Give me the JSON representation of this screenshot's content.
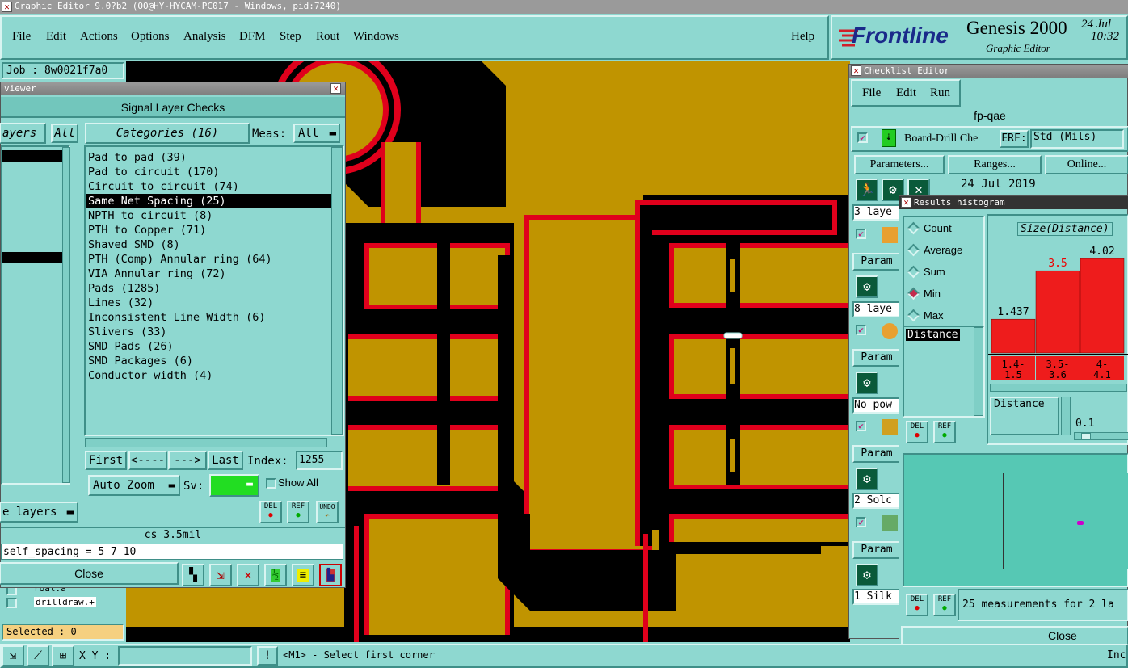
{
  "window_title": "Graphic Editor 9.0?b2 (OO@HY-HYCAM-PC017 - Windows, pid:7240)",
  "menu": [
    "File",
    "Edit",
    "Actions",
    "Options",
    "Analysis",
    "DFM",
    "Step",
    "Rout",
    "Windows"
  ],
  "help": "Help",
  "brand": {
    "logo": "Frontline",
    "product": "Genesis 2000",
    "subtitle": "Graphic Editor",
    "date": "24 Jul",
    "time": "10:32"
  },
  "job": "Job : 8w0021f7a0",
  "viewer": {
    "title": "viewer",
    "heading": "Signal Layer Checks",
    "layers_tab": "ayers",
    "all_tab": "All",
    "categories_label": "Categories (16)",
    "meas_label": "Meas:",
    "meas_value": "All",
    "categories": [
      "Pad to pad (39)",
      "Pad to circuit (170)",
      "Circuit to circuit (74)",
      "Same Net Spacing (25)",
      "NPTH to circuit (8)",
      "PTH to Copper (71)",
      "Shaved SMD (8)",
      "PTH (Comp) Annular ring (64)",
      "VIA Annular ring (72)",
      "Pads (1285)",
      "Lines (32)",
      "Inconsistent Line Width (6)",
      "Slivers (33)",
      "SMD Pads (26)",
      "SMD Packages (6)",
      "Conductor width (4)"
    ],
    "selected_index": 3,
    "nav": {
      "first": "First",
      "prev": "<----",
      "next": "--->",
      "last": "Last",
      "index_label": "Index:",
      "index_value": "1255"
    },
    "auto_zoom": "Auto Zoom",
    "sv_label": "Sv:",
    "show_all": "Show All",
    "layers_dropdown": "e layers",
    "del": "DEL",
    "ref": "REF",
    "undo": "UNDO",
    "info1": "cs 3.5mil",
    "info2": "self_spacing = 5 7 10",
    "close": "Close"
  },
  "layer_list": [
    "roat.a",
    "drilldraw.+"
  ],
  "selected": "Selected : 0",
  "checklist": {
    "title": "Checklist Editor",
    "menu": [
      "File",
      "Edit",
      "Run"
    ],
    "name": "fp-qae",
    "action_name": "Board-Drill Che",
    "erf_label": "ERF:",
    "erf_value": "Std (Mils)",
    "buttons": [
      "Parameters...",
      "Ranges...",
      "Online..."
    ],
    "date": "24 Jul 2019",
    "rows": [
      "3 laye",
      "Param",
      "8 laye",
      "Param",
      "No pow",
      "Param",
      "2 Solc",
      "Param",
      "1 Silk"
    ]
  },
  "histogram": {
    "title": "Results histogram",
    "options": [
      "Count",
      "Average",
      "Sum",
      "Min",
      "Max"
    ],
    "selected_option": "Min",
    "list_item": "Distance",
    "chart_title": "Size(Distance)",
    "bars": [
      {
        "label_top": "1.437",
        "range": "1.4-\n1.5",
        "value": 1.437
      },
      {
        "label_top": "3.5",
        "range": "3.5-\n3.6",
        "value": 3.5
      },
      {
        "label_top": "4.02",
        "range": "4-\n4.1",
        "value": 4.02
      }
    ],
    "distance_field": "Distance",
    "slider_value": "0.1",
    "del": "DEL",
    "ref": "REF",
    "status": "25 measurements for 2 la",
    "close": "Close"
  },
  "bottom": {
    "xy_label": "X Y :",
    "message": "<M1> - Select first corner",
    "right": "Inc"
  },
  "colors": {
    "copper": "#c09400",
    "spacing_marker": "#e0001c",
    "bg": "#8ed8d0"
  }
}
